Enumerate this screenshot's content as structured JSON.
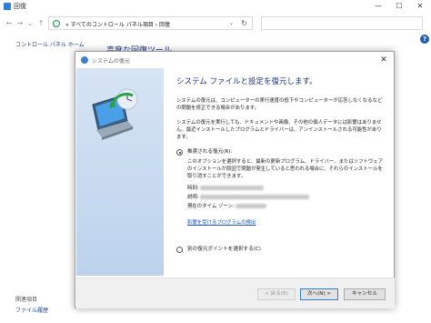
{
  "window": {
    "title": "回復"
  },
  "address": {
    "crumbs": "« すべてのコントロール パネル項目 › 回復",
    "dropdown_glyph": "⌄",
    "refresh_glyph": "↻"
  },
  "nav": {
    "back": "←",
    "forward": "→",
    "up": "↑",
    "recent": "⌄"
  },
  "controls": {
    "minimize": "—",
    "maximize": "☐",
    "close": "✕"
  },
  "help": "?",
  "left": {
    "home_link": "コントロール パネル ホーム",
    "see_also_heading": "関連項目",
    "see_also_link": "ファイル履歴"
  },
  "main": {
    "heading": "高度な回復ツール"
  },
  "dialog": {
    "title": "システムの復元",
    "heading": "システム ファイルと設定を復元します。",
    "para1": "システムの復元は、コンピューターの実行速度の低下やコンピューターが応答しなくなるなどの問題を修正できる場合があります。",
    "para2": "システムの復元を実行しても、ドキュメントや画像、その他の個人データには影響はありません。最近インストールしたプログラムとドライバーは、アンインストールされる可能性があります。",
    "option_recommended": {
      "label": "推奨される復元(R):",
      "selected": true,
      "desc": "このオプションを選択すると、最新の更新プログラム、ドライバー、またはソフトウェアのインストールが原因で問題が発生していると思われる場合に、それらのインストールを取り消すことができます。",
      "time_label": "時刻:",
      "desc_label": "説明:",
      "tz_label": "現在のタイム ゾーン:",
      "link": "影響を受けるプログラムの検出"
    },
    "option_other": {
      "label": "別の復元ポイントを選択する(C)",
      "selected": false
    },
    "buttons": {
      "back": "< 戻る(B)",
      "next": "次へ(N) >",
      "cancel": "キャンセル"
    }
  },
  "colors": {
    "heading": "#1e3287",
    "link": "#1a55c4",
    "accent": "#2f7fd6"
  }
}
